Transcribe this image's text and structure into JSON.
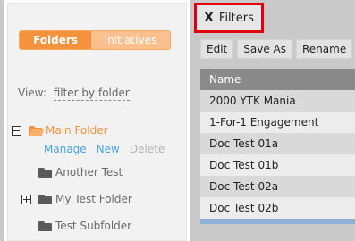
{
  "sidebar": {
    "tabs": [
      {
        "label": "Folders",
        "active": true
      },
      {
        "label": "Initiatives",
        "active": false
      }
    ],
    "view_label": "View:",
    "view_select": "filter by folder",
    "tree": {
      "main": {
        "label": "Main Folder",
        "expanded": true
      },
      "actions": {
        "manage": "Manage",
        "new": "New",
        "delete": "Delete"
      },
      "children": [
        {
          "label": "Another Test"
        },
        {
          "label": "My Test Folder"
        },
        {
          "label": "Test Subfolder"
        }
      ]
    }
  },
  "filters_button": {
    "icon": "X",
    "label": "Filters"
  },
  "toolbar": {
    "edit": "Edit",
    "save_as": "Save As",
    "rename": "Rename"
  },
  "table": {
    "header": "Name",
    "rows": [
      "2000 YTK Mania",
      "1-For-1 Engagement",
      "Doc Test 01a",
      "Doc Test 01b",
      "Doc Test 02a",
      "Doc Test 02b"
    ]
  },
  "colors": {
    "accent": "#f5923e",
    "link": "#4aa3df",
    "highlight_border": "#e3000f"
  }
}
